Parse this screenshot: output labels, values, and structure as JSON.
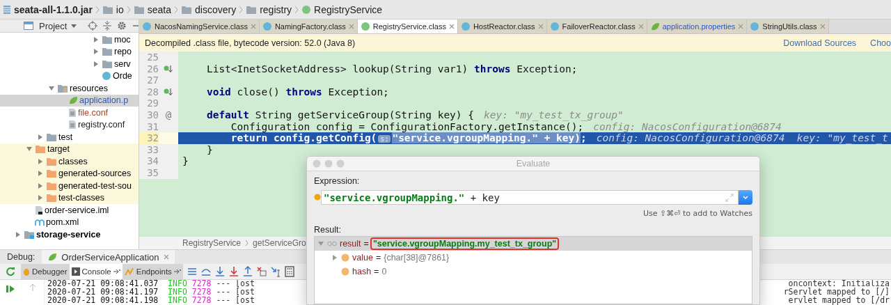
{
  "breadcrumbs": [
    {
      "label": "seata-all-1.1.0.jar",
      "kind": "jar"
    },
    {
      "label": "io",
      "kind": "package"
    },
    {
      "label": "seata",
      "kind": "package"
    },
    {
      "label": "discovery",
      "kind": "package"
    },
    {
      "label": "registry",
      "kind": "package"
    },
    {
      "label": "RegistryService",
      "kind": "interface"
    }
  ],
  "project_panel": {
    "title": "Project",
    "tree": [
      {
        "children": [
          {
            "children": [
              {
                "children": [
                  {
                    "children": [
                      {
                        "children": [
                          {
                            "children": [
                              {
                                "children": [
                                  {
                                    "label": "moc",
                                    "kind": "folder",
                                    "expanded": false,
                                    "selected": false
                                  },
                                  {
                                    "label": "repo",
                                    "kind": "folder",
                                    "expanded": false,
                                    "selected": false
                                  },
                                  {
                                    "label": "serv",
                                    "kind": "folder",
                                    "expanded": false,
                                    "selected": false
                                  },
                                  {
                                    "label": "Orde",
                                    "kind": "class",
                                    "selected": false
                                  }
                                ]
                              }
                            ]
                          }
                        ]
                      }
                    ]
                  },
                  {
                    "label": "resources",
                    "kind": "resources-folder",
                    "expanded": true,
                    "selected": false,
                    "children": [
                      {
                        "label": "application.p",
                        "kind": "spring-file",
                        "selected": true,
                        "color": "#2f55b6"
                      },
                      {
                        "label": "file.conf",
                        "kind": "config-file",
                        "selected": false,
                        "color": "#a8442a"
                      },
                      {
                        "label": "registry.conf",
                        "kind": "config-file",
                        "selected": false,
                        "color": "#222222"
                      }
                    ]
                  }
                ]
              },
              {
                "label": "test",
                "kind": "folder",
                "expanded": false,
                "selected": false
              }
            ]
          },
          {
            "label": "target",
            "kind": "excluded-folder",
            "expanded": true,
            "selected": false,
            "children": [
              {
                "label": "classes",
                "kind": "excluded-folder",
                "expanded": false,
                "selected": false
              },
              {
                "label": "generated-sources",
                "kind": "excluded-folder",
                "expanded": false,
                "selected": false
              },
              {
                "label": "generated-test-sou",
                "kind": "excluded-folder",
                "expanded": false,
                "selected": false
              },
              {
                "label": "test-classes",
                "kind": "excluded-folder",
                "expanded": false,
                "selected": false
              }
            ]
          },
          {
            "label": "order-service.iml",
            "kind": "iml-file",
            "selected": false
          },
          {
            "label": "pom.xml",
            "kind": "pom-file",
            "selected": false
          }
        ]
      },
      {
        "label": "storage-service",
        "kind": "module",
        "expanded": false,
        "selected": false
      }
    ]
  },
  "editor": {
    "tabs": [
      {
        "label": "NacosNamingService.class",
        "kind": "class",
        "selected": false
      },
      {
        "label": "NamingFactory.class",
        "kind": "class",
        "selected": false
      },
      {
        "label": "RegistryService.class",
        "kind": "interface",
        "selected": true
      },
      {
        "label": "HostReactor.class",
        "kind": "class",
        "selected": false
      },
      {
        "label": "FailoverReactor.class",
        "kind": "class",
        "selected": false
      },
      {
        "label": "application.properties",
        "kind": "spring",
        "selected": false
      },
      {
        "label": "StringUtils.class",
        "kind": "class",
        "selected": false
      }
    ],
    "banner": {
      "text": "Decompiled .class file, bytecode version: 52.0 (Java 8)",
      "links": [
        "Download Sources",
        "Choo"
      ]
    },
    "lines": [
      {
        "number": "25",
        "selected": false
      },
      {
        "number": "26",
        "selected": false,
        "gutter": {
          "kind": "implemented"
        },
        "tokens": [
          {
            "kind": "plain",
            "text": "    List<InetSocketAddress> lookup(String var1) "
          },
          {
            "kind": "keyword",
            "text": "throws"
          },
          {
            "kind": "plain",
            "text": " Exception;"
          }
        ]
      },
      {
        "number": "27",
        "selected": false
      },
      {
        "number": "28",
        "selected": false,
        "gutter": {
          "kind": "implemented"
        },
        "tokens": [
          {
            "kind": "keyword",
            "text": "    void"
          },
          {
            "kind": "plain",
            "text": " close() "
          },
          {
            "kind": "keyword",
            "text": "throws"
          },
          {
            "kind": "plain",
            "text": " Exception;"
          }
        ]
      },
      {
        "number": "29",
        "selected": false
      },
      {
        "number": "30",
        "selected": false,
        "gutter": {
          "kind": "text",
          "text": "@"
        },
        "tokens": [
          {
            "kind": "keyword",
            "text": "    default"
          },
          {
            "kind": "plain",
            "text": " String getServiceGroup(String key) {"
          }
        ],
        "hint": "key: \"my_test_tx_group\""
      },
      {
        "number": "31",
        "selected": false,
        "tokens": [
          {
            "kind": "plain",
            "text": "        Configuration config = ConfigurationFactory.getInstance();"
          }
        ],
        "hint": "config: NacosConfiguration@6874"
      },
      {
        "number": "32",
        "selected": true,
        "tokens": [
          {
            "kind": "keyword",
            "text": "        return"
          },
          {
            "kind": "plain",
            "text": " config.getConfig("
          },
          {
            "kind": "badge",
            "text": "s:"
          },
          {
            "kind": "selection",
            "text": "\"service.vgroupMapping.\" + key)"
          },
          {
            "kind": "plain",
            "text": ";"
          }
        ],
        "hint": "config: NacosConfiguration@6874  key: \"my_test_t"
      },
      {
        "number": "33",
        "selected": false,
        "tokens": [
          {
            "kind": "plain",
            "text": "    }"
          }
        ]
      },
      {
        "number": "34",
        "selected": false,
        "tokens": [
          {
            "kind": "plain",
            "text": "}"
          }
        ]
      },
      {
        "number": "35",
        "selected": false
      }
    ],
    "breadcrumbs": [
      "RegistryService",
      "getServiceGro"
    ]
  },
  "debug": {
    "label": "Debug:",
    "session_tab": "OrderServiceApplication",
    "tabs": [
      {
        "label": "Debugger",
        "kind": "debugger",
        "selected": false
      },
      {
        "label": "Console",
        "kind": "console",
        "selected": true
      },
      {
        "label": "Endpoints",
        "kind": "endpoints",
        "selected": false
      }
    ],
    "console_lines": [
      {
        "tokens": [
          {
            "kind": "timestamp",
            "text": "2020-07-21 09:08:41.037"
          },
          {
            "kind": "level",
            "text": "INFO"
          },
          {
            "kind": "pid",
            "text": "7278"
          },
          {
            "kind": "plain",
            "text": "---"
          },
          {
            "kind": "plain",
            "text": "[ost"
          }
        ],
        "tail": "oncontext: Initializa"
      },
      {
        "tokens": [
          {
            "kind": "timestamp",
            "text": "2020-07-21 09:08:41.197"
          },
          {
            "kind": "level",
            "text": "INFO"
          },
          {
            "kind": "pid",
            "text": "7278"
          },
          {
            "kind": "plain",
            "text": "---"
          },
          {
            "kind": "plain",
            "text": "[ost"
          }
        ],
        "tail": "rServlet mapped to [/]"
      },
      {
        "tokens": [
          {
            "kind": "timestamp",
            "text": "2020-07-21 09:08:41.198"
          },
          {
            "kind": "level",
            "text": "INFO"
          },
          {
            "kind": "pid",
            "text": "7278"
          },
          {
            "kind": "plain",
            "text": "---"
          },
          {
            "kind": "plain",
            "text": "[ost"
          }
        ],
        "tail": "ervlet mapped to [/dr"
      }
    ]
  },
  "evaluate_dialog": {
    "title": "Evaluate",
    "expression_label": "Expression:",
    "expression": [
      {
        "kind": "string",
        "text": "\"service.vgroupMapping.\""
      },
      {
        "kind": "plain",
        "text": " + key"
      }
    ],
    "hint": "Use ⇧⌘⏎ to add to Watches",
    "result_label": "Result:",
    "results": [
      {
        "name": "result",
        "operator": "=",
        "value": "\"service.vgroupMapping.my_test_tx_group\"",
        "kind": "watch",
        "selected": true,
        "expanded": true,
        "annotated": true,
        "children": [
          {
            "name": "value",
            "operator": "=",
            "value": "{char[38]@7861}",
            "kind": "field",
            "selected": false,
            "expanded": false,
            "annotated": false
          },
          {
            "name": "hash",
            "operator": "=",
            "value": "0",
            "kind": "field",
            "selected": false,
            "annotated": false
          }
        ]
      }
    ]
  }
}
